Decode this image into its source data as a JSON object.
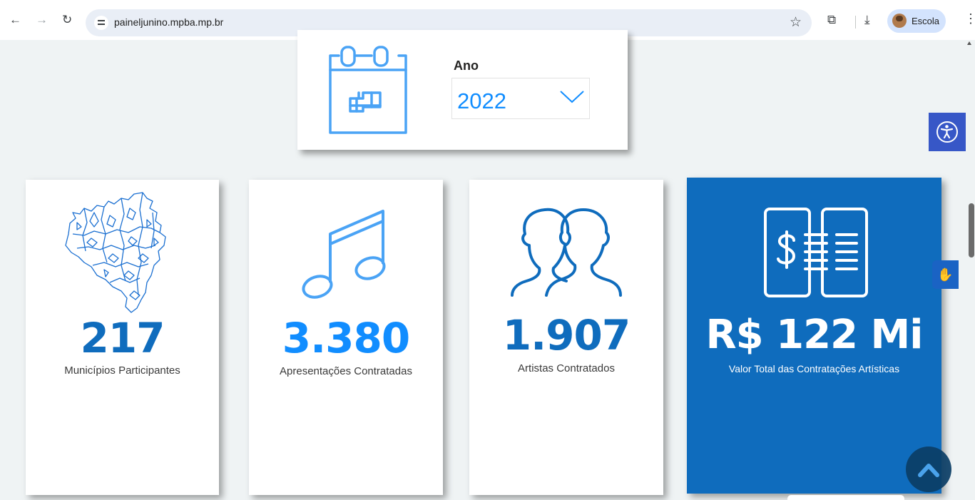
{
  "browser": {
    "url": "paineljunino.mpba.mp.br",
    "profile_name": "Escola",
    "back_icon": "arrow-left-icon",
    "forward_icon": "arrow-right-icon",
    "reload_icon": "reload-icon"
  },
  "filter": {
    "label": "Ano",
    "selected_year": "2022"
  },
  "kpis": [
    {
      "value": "217",
      "label": "Municípios Participantes",
      "icon": "bahia-map-icon",
      "color": "#0f6cbd"
    },
    {
      "value": "3.380",
      "label": "Apresentações Contratadas",
      "icon": "music-note-icon",
      "color": "#118dff"
    },
    {
      "value": "1.907",
      "label": "Artistas Contratados",
      "icon": "people-icon",
      "color": "#0f6cbd"
    },
    {
      "value": "R$ 122 Mi",
      "label": "Valor Total das Contratações Artísticas",
      "icon": "contract-money-icon",
      "color": "#ffffff"
    }
  ],
  "colors": {
    "accent": "#118dff",
    "dark_blue": "#0f6cbd",
    "background": "#eff3f4"
  }
}
